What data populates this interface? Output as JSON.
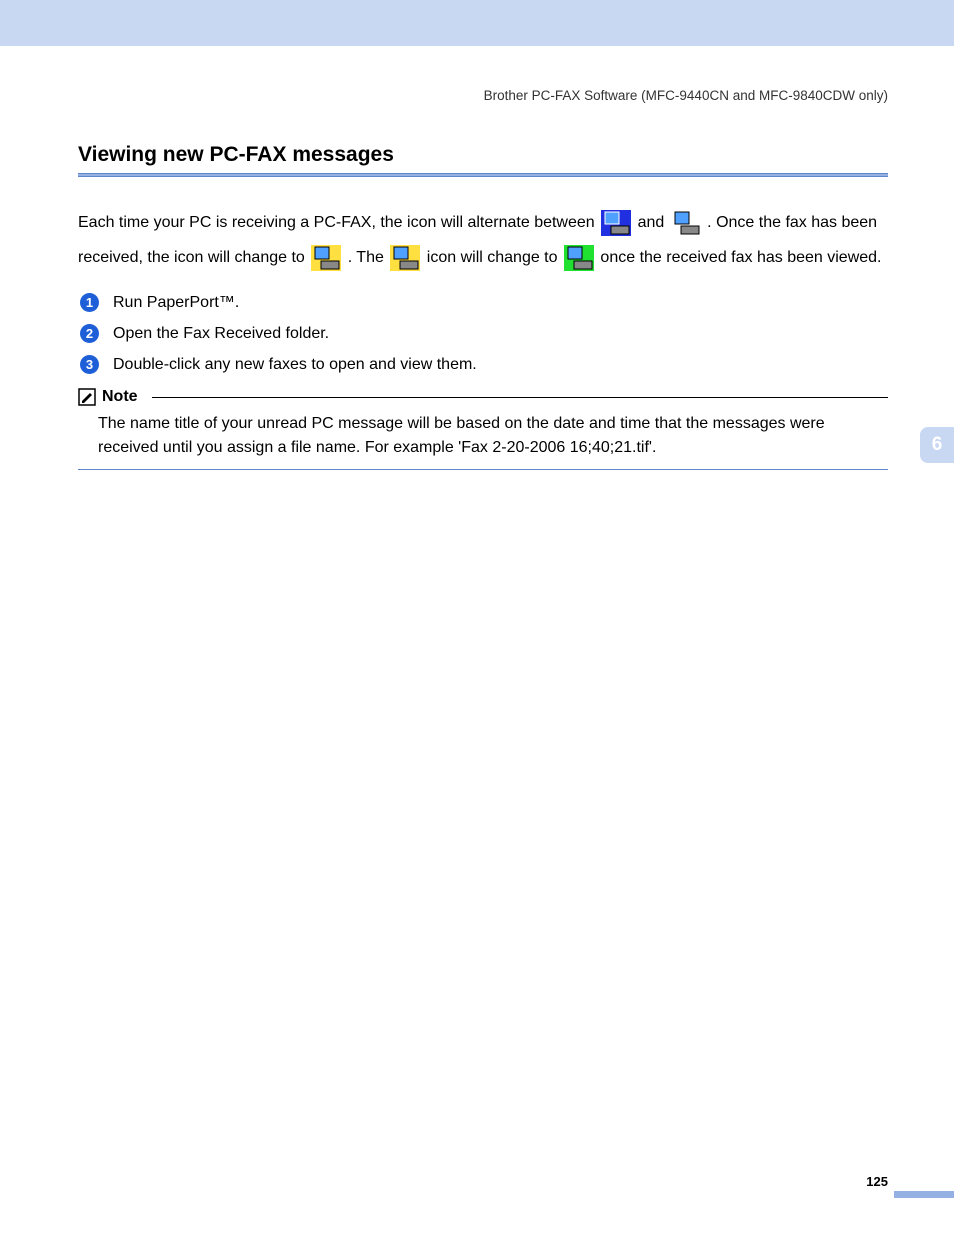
{
  "header": "Brother PC-FAX Software (MFC-9440CN and MFC-9840CDW only)",
  "title": "Viewing new PC-FAX messages",
  "intro": {
    "part1": "Each time your PC is receiving a PC-FAX, the icon will alternate between ",
    "part2": " and ",
    "part3": ". Once the fax has been received, the icon will change to ",
    "part4": ". The ",
    "part5": " icon will change to ",
    "part6": " once the received fax has been viewed."
  },
  "steps": [
    "Run PaperPort™.",
    "Open the Fax Received folder.",
    "Double-click any new faxes to open and view them."
  ],
  "note": {
    "label": "Note",
    "body": "The name title of your unread PC message will be based on the date and time that the messages were received until you assign a file name. For example 'Fax 2-20-2006 16;40;21.tif'."
  },
  "chapter": "6",
  "page": "125"
}
